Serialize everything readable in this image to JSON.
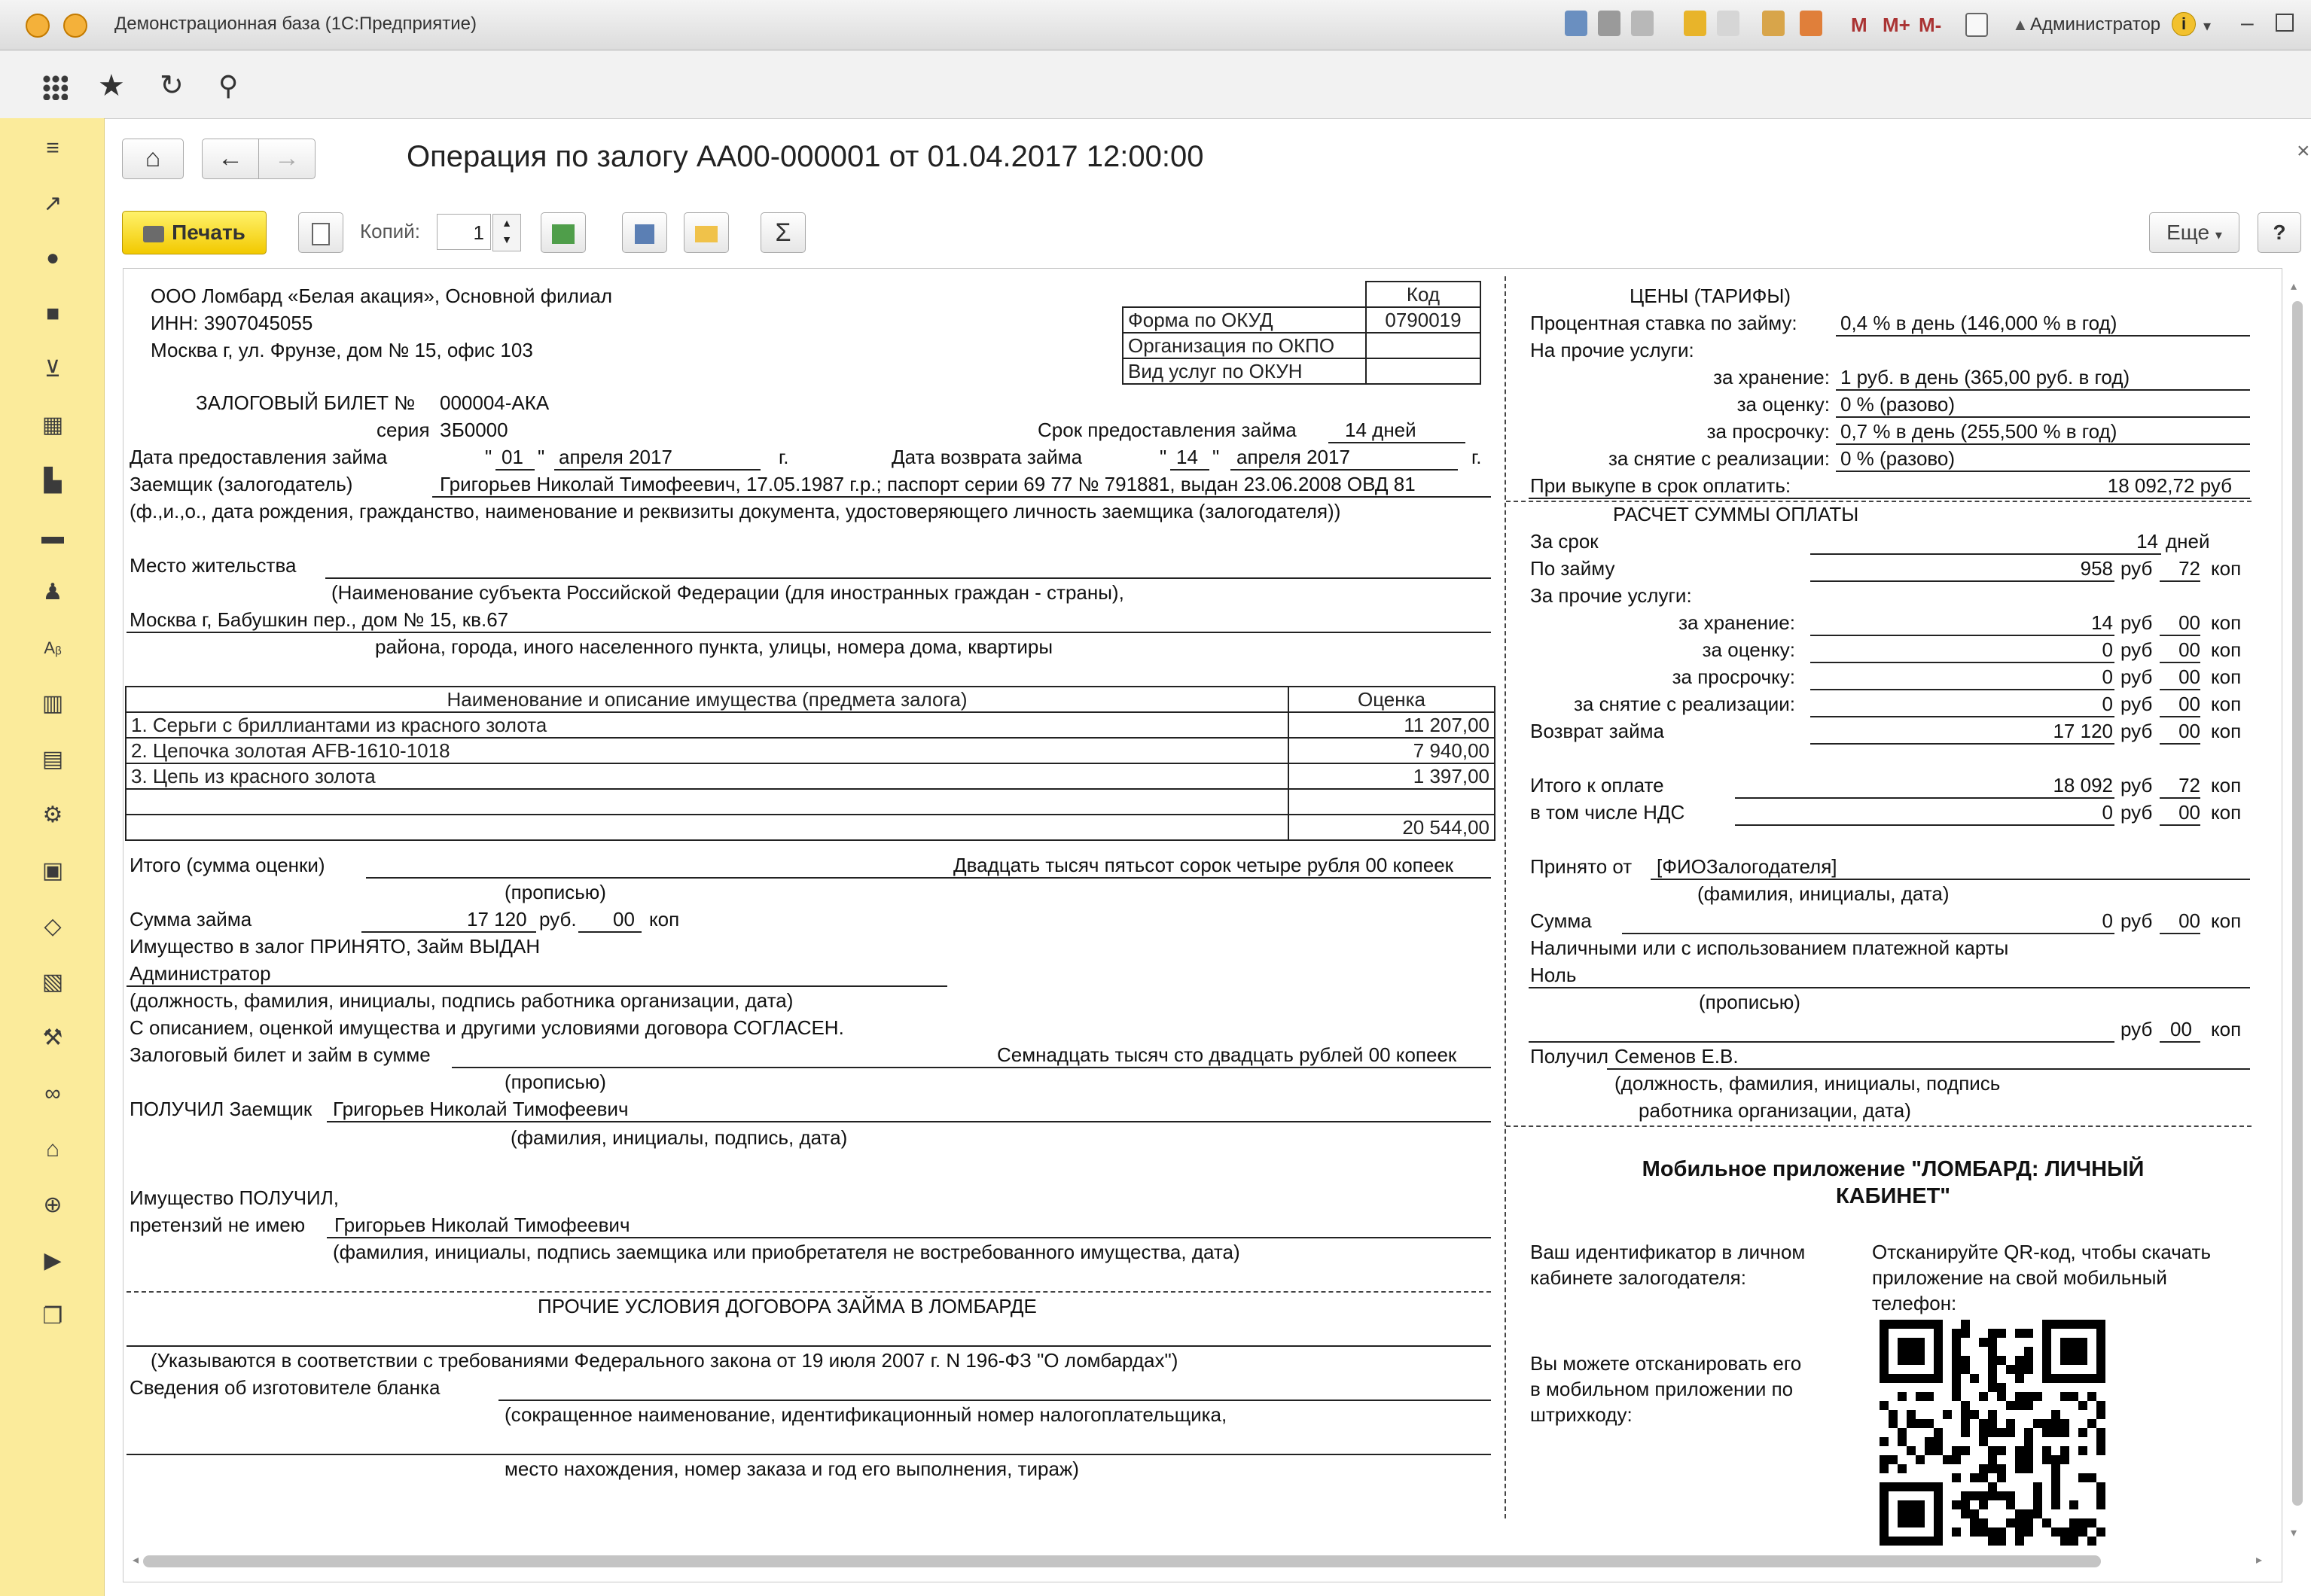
{
  "window": {
    "title": "Демонстрационная база  (1С:Предприятие)",
    "user": "Администратор",
    "m_buttons": [
      "M",
      "M+",
      "M-"
    ]
  },
  "header": {
    "title": "Операция по залогу АА00-000001 от 01.04.2017 12:00:00",
    "home_glyph": "⌂",
    "back_glyph": "←",
    "forward_glyph": "→",
    "close_glyph": "×"
  },
  "commandbar": {
    "print_label": "Печать",
    "copies_label": "Копий:",
    "copies_value": "1",
    "sum_glyph": "Σ",
    "more_label": "Еще",
    "help_label": "?"
  },
  "ticket": {
    "org_line1": "ООО Ломбард «Белая акация», Основной филиал",
    "org_inn": "ИНН: 3907045055",
    "org_address": "Москва г, ул. Фрунзе, дом № 15, офис 103",
    "code_header": "Код",
    "codes": [
      {
        "label": "Форма по ОКУД",
        "value": "0790019"
      },
      {
        "label": "Организация по ОКПО",
        "value": ""
      },
      {
        "label": "Вид услуг по ОКУН",
        "value": ""
      }
    ],
    "ticket_title": "ЗАЛОГОВЫЙ БИЛЕТ №",
    "ticket_number": "000004-АКА",
    "series_label": "серия",
    "series_value": "ЗБ0000",
    "term_label": "Срок предоставления займа",
    "term_value": "14 дней",
    "date_given_label": "Дата предоставления займа",
    "date_given_day": "01",
    "date_given_month": "апреля 2017",
    "year_suffix": "г.",
    "date_return_label": "Дата возврата займа",
    "date_return_day": "14",
    "date_return_month": "апреля 2017",
    "borrower_label": "Заемщик (залогодатель)",
    "borrower_value": "Григорьев Николай Тимофеевич, 17.05.1987 г.р.; паспорт серии 69 77 № 791881, выдан 23.06.2008 ОВД 81",
    "borrower_hint": "(ф.,и.,о., дата рождения, гражданство, наименование и реквизиты документа, удостоверяющего личность заемщика (залогодателя))",
    "residence_label": "Место жительства",
    "residence_hint1": "(Наименование субъекта Российской Федерации (для иностранных граждан - страны),",
    "residence_value": "Москва г, Бабушкин пер., дом № 15, кв.67",
    "residence_hint2": "района, города, иного населенного пункта, улицы, номера дома, квартиры",
    "items_header_name": "Наименование и описание имущества (предмета залога)",
    "items_header_value": "Оценка",
    "items": [
      {
        "name": "1. Серьги с бриллиантами из красного золота",
        "value": "11 207,00"
      },
      {
        "name": "2. Цепочка золотая AFB-1610-1018",
        "value": "7 940,00"
      },
      {
        "name": "3. Цепь из красного золота",
        "value": "1 397,00"
      },
      {
        "name": "",
        "value": ""
      }
    ],
    "items_total": "20 544,00",
    "total_label": "Итого (сумма оценки)",
    "total_words": "Двадцать тысяч пятьсот сорок четыре рубля 00 копеек",
    "in_words_hint": "(прописью)",
    "loan_label": "Сумма займа",
    "loan_rub": "17 120",
    "rub_label": "руб.",
    "loan_kop": "00",
    "kop_label": "коп",
    "accepted_line": "Имущество в залог ПРИНЯТО, Займ ВЫДАН",
    "employee": "Администратор",
    "employee_hint": "(должность, фамилия, инициалы, подпись работника организации, дата)",
    "agree_line": "С описанием, оценкой имущества и другими условиями договора СОГЛАСЕН.",
    "ticket_sum_label": "Залоговый билет и займ в сумме",
    "ticket_sum_words": "Семнадцать тысяч сто двадцать рублей 00 копеек",
    "received_label": "ПОЛУЧИЛ Заемщик",
    "received_value": "Григорьев Николай Тимофеевич",
    "received_hint": "(фамилия, инициалы, подпись, дата)",
    "property_received": "Имущество ПОЛУЧИЛ,",
    "no_claims_label": "претензий не имею",
    "no_claims_value": "Григорьев Николай Тимофеевич",
    "no_claims_hint": "(фамилия, инициалы, подпись заемщика или приобретателя не востребованного имущества, дата)",
    "other_terms_title": "ПРОЧИЕ УСЛОВИЯ ДОГОВОРА ЗАЙМА В ЛОМБАРДЕ",
    "law_line": "(Указываются в соответствии с требованиями Федерального закона от 19 июля 2007 г. N 196-ФЗ \"О ломбардах\")",
    "maker_label": "Сведения об изготовителе бланка",
    "maker_hint1": "(сокращенное наименование, идентификационный номер налогоплательщика,",
    "maker_hint2": "место нахождения, номер заказа и год его выполнения, тираж)"
  },
  "tariffs": {
    "title": "ЦЕНЫ (ТАРИФЫ)",
    "rate_label": "Процентная ставка по займу:",
    "rate_value": "0,4 % в день (146,000 % в год)",
    "other_label": "На прочие услуги:",
    "storage_label": "за хранение:",
    "storage_value": "1 руб. в день (365,00 руб. в год)",
    "appraisal_label": "за оценку:",
    "appraisal_value": "0 % (разово)",
    "overdue_label": "за просрочку:",
    "overdue_value": "0,7 % в день (255,500 % в год)",
    "sale_label": "за снятие с реализации:",
    "sale_value": "0 % (разово)",
    "buyout_label": "При выкупе в срок оплатить:",
    "buyout_value": "18 092,72  руб"
  },
  "calc": {
    "title": "РАСЧЕТ СУММЫ ОПЛАТЫ",
    "term_label": "За срок",
    "term_value": "14",
    "days_label": "дней",
    "rub": "руб",
    "kop": "коп",
    "rows": [
      {
        "label": "По займу",
        "rub": "958",
        "kop": "72"
      },
      {
        "label": "за хранение:",
        "rub": "14",
        "kop": "00"
      },
      {
        "label": "за оценку:",
        "rub": "0",
        "kop": "00"
      },
      {
        "label": "за просрочку:",
        "rub": "0",
        "kop": "00"
      },
      {
        "label": "за снятие с реализации:",
        "rub": "0",
        "kop": "00"
      },
      {
        "label": "Возврат займа",
        "rub": "17 120",
        "kop": "00"
      }
    ],
    "other_label": "За прочие услуги:",
    "total_label": "Итого к оплате",
    "total_rub": "18 092",
    "total_kop": "72",
    "vat_label": "в том числе НДС",
    "vat_rub": "0",
    "vat_kop": "00",
    "from_label": "Принято от",
    "from_value": "[ФИОЗалогодателя]",
    "from_hint": "(фамилия, инициалы, дата)",
    "sum_label": "Сумма",
    "sum_rub": "0",
    "sum_kop": "00",
    "cash_line": "Наличными или с использованием платежной карты",
    "zero_words": "Ноль",
    "in_words": "(прописью)",
    "words_kop": "00",
    "got_label": "Получил",
    "got_value": "Семенов Е.В.",
    "got_hint1": "(должность, фамилия, инициалы, подпись",
    "got_hint2": "работника организации, дата)"
  },
  "mobile": {
    "title1": "Мобильное приложение \"ЛОМБАРД: ЛИЧНЫЙ",
    "title2": "КАБИНЕТ\"",
    "id_text1": "Ваш идентификатор в личном",
    "id_text2": "кабинете залогодателя:",
    "qr_text1": "Отсканируйте QR-код, чтобы скачать",
    "qr_text2": "приложение на свой мобильный",
    "qr_text3": "телефон:",
    "scan_text1": "Вы можете отсканировать его",
    "scan_text2": "в мобильном приложении по",
    "scan_text3": "штрихкоду:"
  }
}
